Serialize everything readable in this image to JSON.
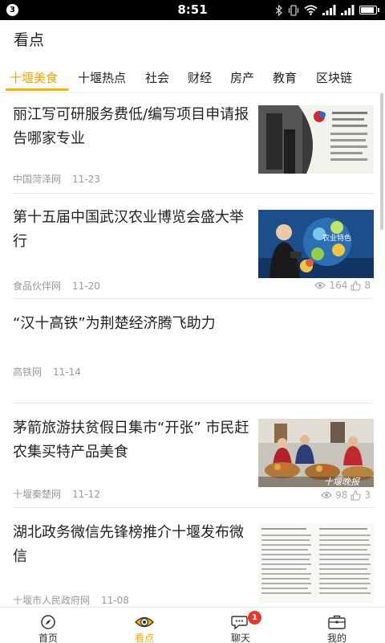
{
  "status_bar": {
    "notification_count": "3",
    "time": "8:51",
    "icons": [
      "bluetooth-icon",
      "vibrate-icon",
      "wifi-icon",
      "signal-icon",
      "signal-icon",
      "battery-icon"
    ]
  },
  "header": {
    "title": "看点"
  },
  "tabs": [
    {
      "label": "十堰美食",
      "active": true
    },
    {
      "label": "十堰热点"
    },
    {
      "label": "社会"
    },
    {
      "label": "财经"
    },
    {
      "label": "房产"
    },
    {
      "label": "教育"
    },
    {
      "label": "区块链"
    }
  ],
  "articles": [
    {
      "title": "丽江写可研服务费低/编写项目申请报告哪家专业",
      "source": "中国菏泽网",
      "date": "11-23",
      "thumbnail": "document-photo"
    },
    {
      "title": "第十五届中国武汉农业博览会盛大举行",
      "source": "食品伙伴网",
      "date": "11-20",
      "views": "164",
      "likes": "8",
      "thumbnail": "expo-photo",
      "thumb_text": "农业特色"
    },
    {
      "title": "“汉十高铁”为荆楚经济腾飞助力",
      "source": "高铁网",
      "date": "11-14"
    },
    {
      "title": "茅箭旅游扶贫假日集市“开张” 市民赶农集买特产品美食",
      "source": "十堰秦楚网",
      "date": "11-12",
      "views": "98",
      "likes": "3",
      "thumbnail": "market-photo",
      "thumb_text": "十堰晚报"
    },
    {
      "title": "湖北政务微信先锋榜推介十堰发布微信",
      "source": "十堰市人民政府网",
      "date": "11-08",
      "thumbnail": "newspaper-photo"
    }
  ],
  "bottom_nav": [
    {
      "label": "首页",
      "icon": "compass-icon"
    },
    {
      "label": "看点",
      "icon": "eye-icon",
      "active": true
    },
    {
      "label": "聊天",
      "icon": "chat-icon",
      "badge": "1"
    },
    {
      "label": "我的",
      "icon": "briefcase-icon"
    }
  ],
  "colors": {
    "accent": "#f0a400",
    "badge": "#e8352d",
    "meta_text": "#999999"
  }
}
